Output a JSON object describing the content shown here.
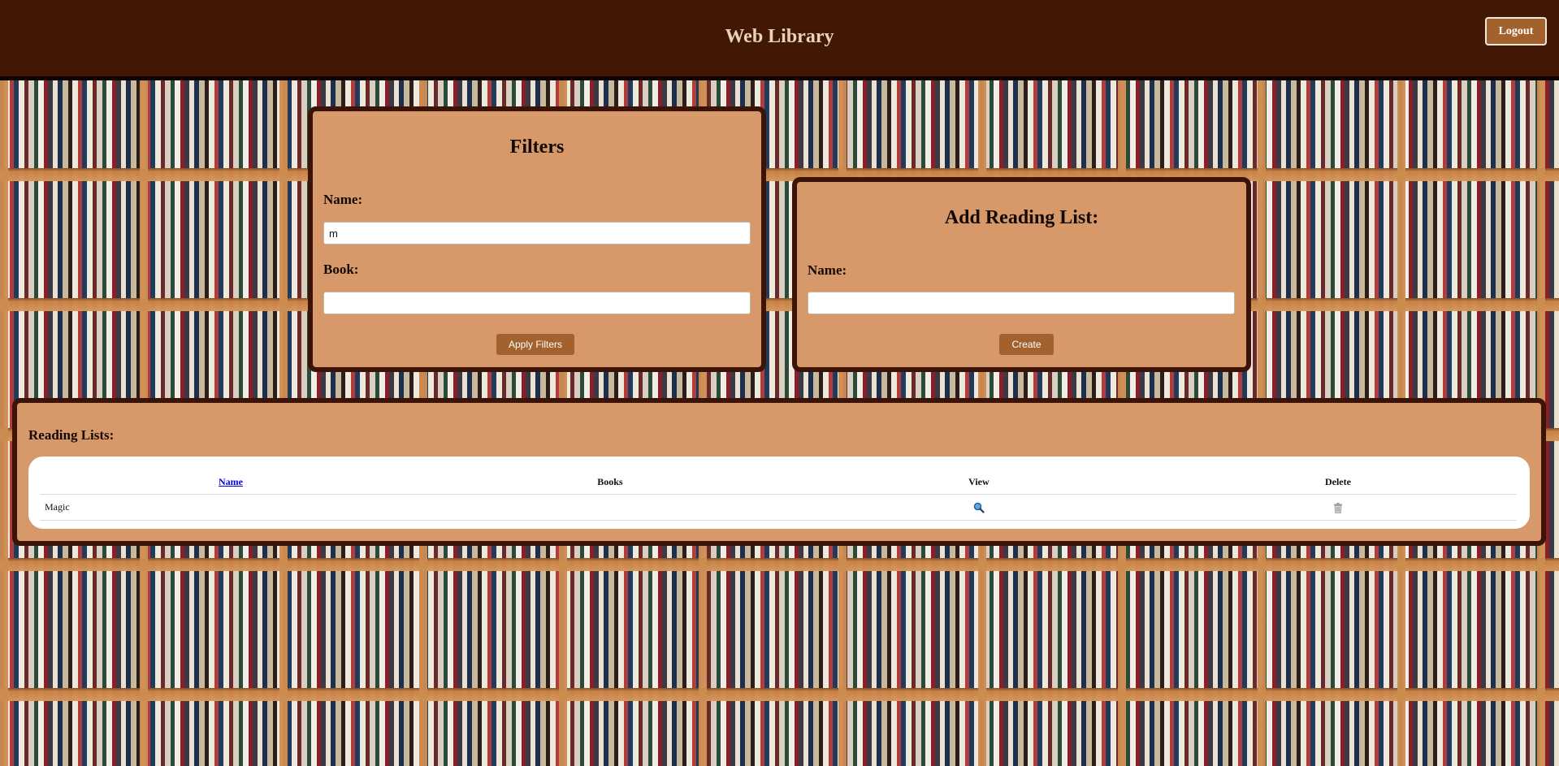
{
  "app": {
    "title": "Web Library"
  },
  "header": {
    "logout_label": "Logout"
  },
  "filters": {
    "title": "Filters",
    "name_label": "Name:",
    "name_value": "m",
    "book_label": "Book:",
    "book_value": "",
    "apply_label": "Apply Filters"
  },
  "add_reading_list": {
    "title": "Add Reading List:",
    "name_label": "Name:",
    "name_value": "",
    "create_label": "Create"
  },
  "reading_lists": {
    "title": "Reading Lists:",
    "columns": [
      "Name",
      "Books",
      "View",
      "Delete"
    ],
    "rows": [
      {
        "name": "Magic",
        "books": "",
        "view_icon": "magnifier-icon",
        "delete_icon": "trash-icon"
      }
    ]
  },
  "colors": {
    "header_bg": "#421705",
    "panel_bg": "#d7996a",
    "panel_border": "#3b1407",
    "button_bg": "#a2612d",
    "title_text": "#e9d2b5"
  }
}
